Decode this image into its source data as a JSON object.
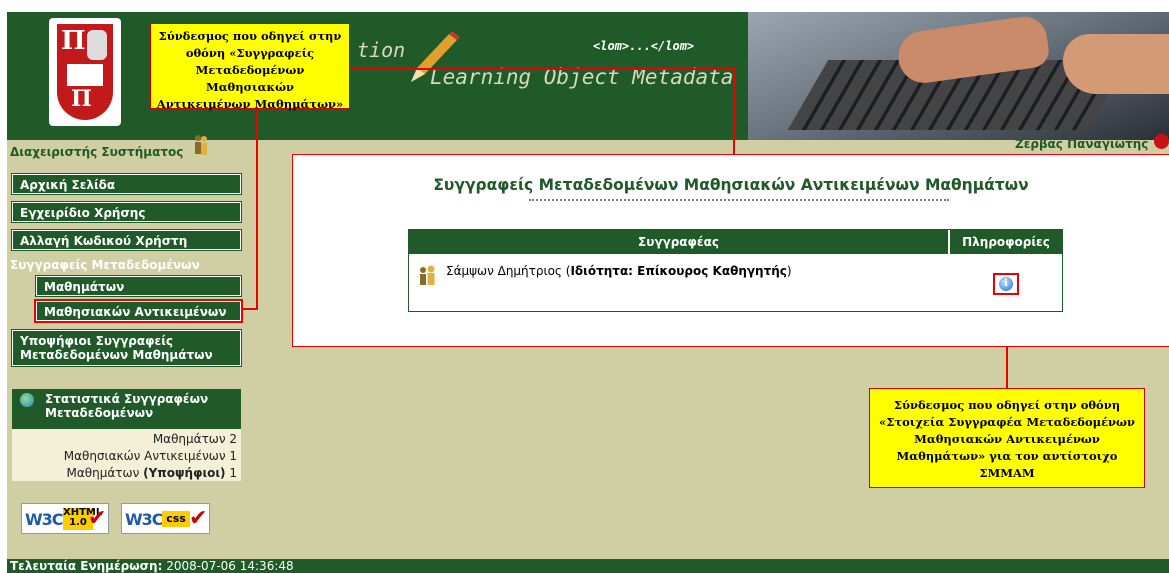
{
  "header": {
    "subtitle_fragment": "tion",
    "title": "Learning Object Metadata",
    "lom_tag": "<lom>...</lom>"
  },
  "annotations": {
    "top": [
      "Σύνδεσμος που οδηγεί στην",
      "οθόνη «Συγγραφείς",
      "Μεταδεδομένων Μαθησιακών",
      "Αντικειμένων Μαθημάτων»"
    ],
    "bottom": [
      "Σύνδεσμος που οδηγεί στην οθόνη",
      "«Στοιχεία Συγγραφέα Μεταδεδομένων",
      "Μαθησιακών Αντικειμένων",
      "Μαθημάτων» για τον αντίστοιχο",
      "ΣΜΜΑΜ"
    ]
  },
  "userbar": {
    "role": "Διαχειριστής Συστήματος",
    "user": "Ζέρβας Παναγιώτης"
  },
  "sidebar": {
    "home": "Αρχική Σελίδα",
    "manual": "Εγχειρίδιο Χρήσης",
    "change_password": "Αλλαγή Κωδικού Χρήστη",
    "section": "Συγγραφείς Μεταδεδομένων",
    "courses": "Μαθημάτων",
    "learning_objects": "Μαθησιακών Αντικειμένων",
    "candidates_line1": "Υποψήφιοι Συγγραφείς",
    "candidates_line2": "Μεταδεδομένων Μαθημάτων"
  },
  "stats": {
    "title_line1": "Στατιστικά Συγγραφέων",
    "title_line2": "Μεταδεδομένων",
    "row1": "Μαθημάτων 2",
    "row2": "Μαθησιακών Αντικειμένων 1",
    "row3_prefix": "Μαθημάτων ",
    "row3_bold": "(Υποψήφιοι)",
    "row3_value": " 1"
  },
  "badges": {
    "w3c": "W3C",
    "xhtml": "XHTML",
    "xhtml_version": "1.0",
    "css": "css"
  },
  "footer": {
    "label": "Τελευταία Ενημέρωση:",
    "value": " 2008-07-06 14:36:48"
  },
  "main": {
    "title": "Συγγραφείς Μεταδεδομένων Μαθησιακών Αντικειμένων Μαθημάτων",
    "col_author": "Συγγραφέας",
    "col_info": "Πληροφορίες",
    "author_name": "Σάμψων Δημήτριος (",
    "author_role_label": "Ιδιότητα: Επίκουρος Καθηγητής",
    "author_close": ")",
    "info_glyph": "i"
  },
  "colors": {
    "accent_green": "#1f5a28",
    "background": "#cfcfa3",
    "annotation_fill": "#ffff00",
    "annotation_line": "#ee0000"
  }
}
